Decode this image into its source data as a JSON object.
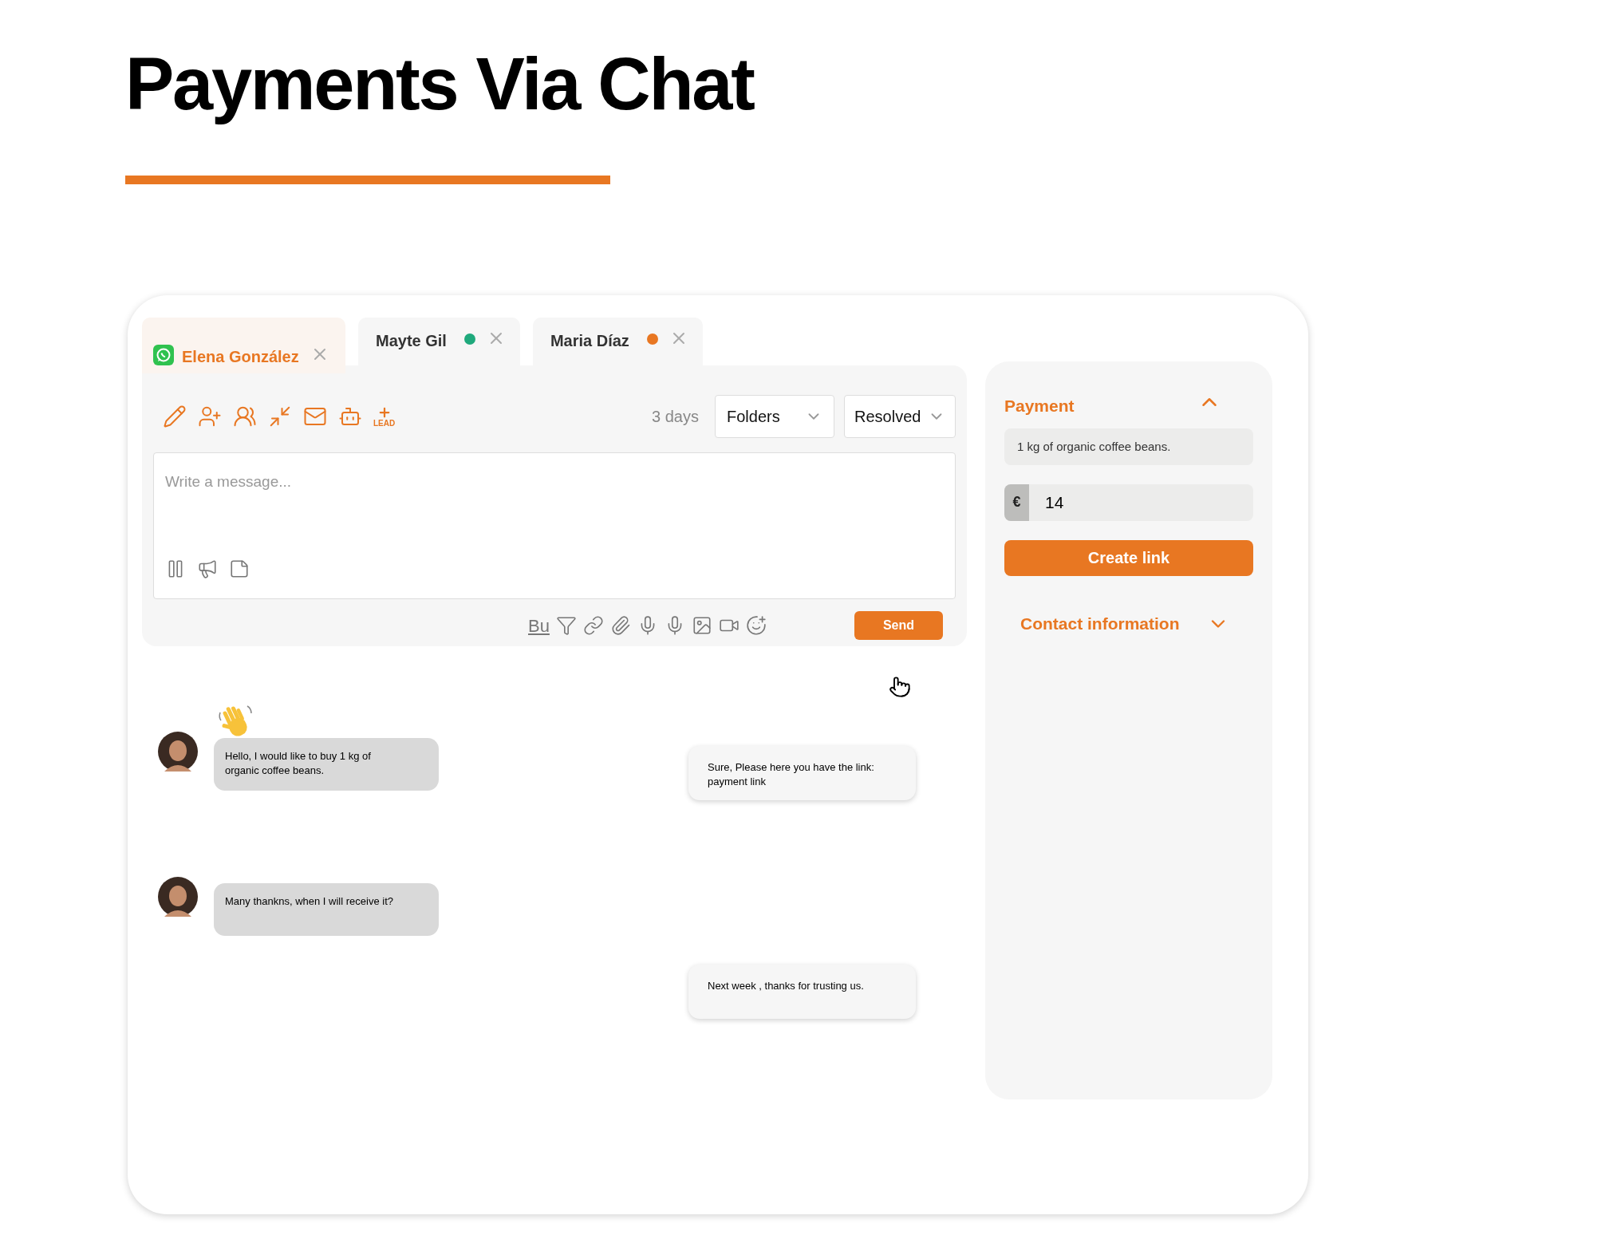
{
  "page_title": "Payments Via Chat",
  "tabs": [
    {
      "label": "Elena González",
      "selected": true,
      "kind": "whatsapp"
    },
    {
      "label": "Mayte Gil",
      "selected": false,
      "kind": "status",
      "color": "#1fa97c"
    },
    {
      "label": "Maria Díaz",
      "selected": false,
      "kind": "status",
      "color": "#e87722"
    }
  ],
  "toolbar": {
    "lead_label": "LEAD",
    "age": "3 days",
    "folders": "Folders",
    "status": "Resolved"
  },
  "composer": {
    "placeholder": "Write a message...",
    "format_label": "Bu",
    "send": "Send"
  },
  "messages": [
    {
      "kind": "incoming",
      "text": "Hello, I would like to buy 1 kg of organic coffee beans.",
      "wave": true
    },
    {
      "kind": "outgoing",
      "text": "Sure, Please here you have the link: payment link"
    },
    {
      "kind": "incoming",
      "text": "Many thankns, when I will receive it?",
      "wave": false
    },
    {
      "kind": "outgoing",
      "text": "Next week , thanks for trusting us."
    }
  ],
  "payment": {
    "title": "Payment",
    "expanded": true,
    "description": "1 kg of organic coffee beans.",
    "currency": "€",
    "amount": "14",
    "button": "Create link"
  },
  "contact": {
    "title": "Contact information",
    "expanded": false
  }
}
